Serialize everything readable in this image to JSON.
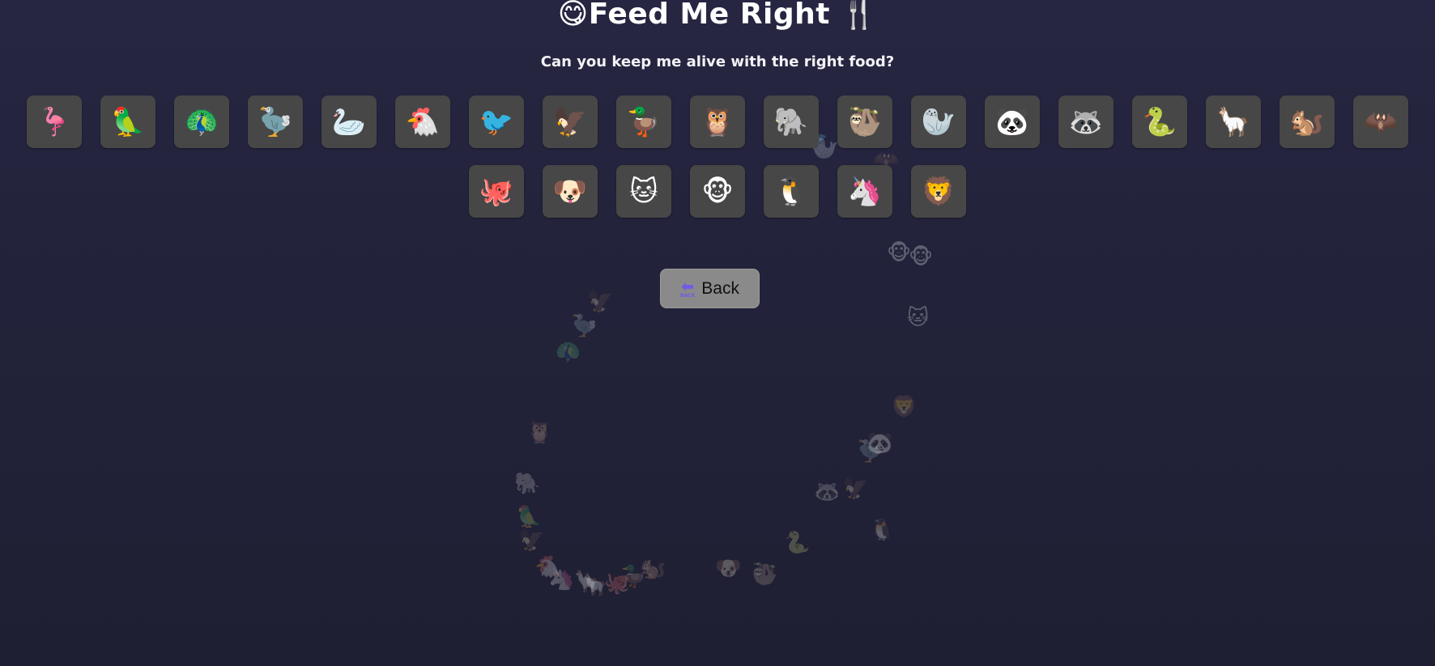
{
  "header": {
    "title_icon": "😋",
    "title_text": "Feed Me Right",
    "title_icon_right": "🍴",
    "subtitle": "Can you keep me alive with the right food?"
  },
  "animals": [
    {
      "id": "flamingo",
      "emoji": "🦩"
    },
    {
      "id": "parrot",
      "emoji": "🦜"
    },
    {
      "id": "peacock",
      "emoji": "🦚"
    },
    {
      "id": "dodo",
      "emoji": "🦤"
    },
    {
      "id": "swan",
      "emoji": "🦢"
    },
    {
      "id": "chicken",
      "emoji": "🐔"
    },
    {
      "id": "bird",
      "emoji": "🐦"
    },
    {
      "id": "eagle",
      "emoji": "🦅"
    },
    {
      "id": "duck",
      "emoji": "🦆"
    },
    {
      "id": "owl",
      "emoji": "🦉"
    },
    {
      "id": "elephant",
      "emoji": "🐘"
    },
    {
      "id": "sloth",
      "emoji": "🦥"
    },
    {
      "id": "seal",
      "emoji": "🦭"
    },
    {
      "id": "panda",
      "emoji": "🐼"
    },
    {
      "id": "raccoon",
      "emoji": "🦝"
    },
    {
      "id": "snake",
      "emoji": "🐍"
    },
    {
      "id": "llama",
      "emoji": "🦙"
    },
    {
      "id": "squirrel",
      "emoji": "🐿️"
    },
    {
      "id": "bat",
      "emoji": "🦇"
    },
    {
      "id": "octopus",
      "emoji": "🐙"
    },
    {
      "id": "dog",
      "emoji": "🐶"
    },
    {
      "id": "cat",
      "emoji": "🐱"
    },
    {
      "id": "monkey",
      "emoji": "🐵"
    },
    {
      "id": "penguin",
      "emoji": "🐧"
    },
    {
      "id": "unicorn",
      "emoji": "🦄"
    },
    {
      "id": "lion",
      "emoji": "🦁"
    }
  ],
  "back_button": {
    "icon": "🔙",
    "icon_arrow": "⬅",
    "icon_text": "BACK",
    "label": "Back"
  },
  "background_animals": [
    "🦅",
    "🦤",
    "🦚",
    "🦉",
    "🐘",
    "🦜",
    "🦅",
    "🐔",
    "🦄",
    "🦙",
    "🦙",
    "🐙",
    "🦆",
    "🐿️",
    "🐶",
    "🦢",
    "🦥",
    "🐍",
    "🦝",
    "🐼",
    "🐧",
    "🦁",
    "🐵",
    "🐱",
    "🐵",
    "🦤",
    "🦅",
    "🐦",
    "🦇",
    "🦭"
  ],
  "colors": {
    "background": "#24243d",
    "card": "#474747",
    "back_button": "#8a8a8a",
    "back_icon": "#6d5ce6",
    "text": "#ffffff"
  }
}
